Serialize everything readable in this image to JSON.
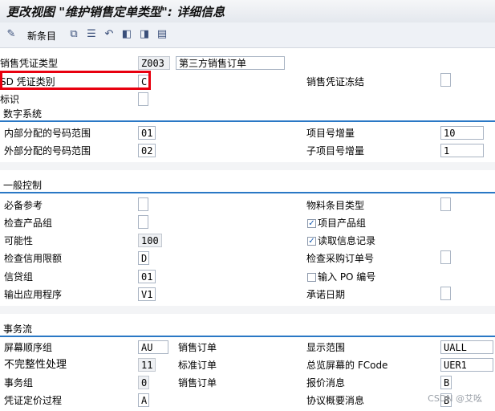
{
  "window": {
    "title": "更改视图 \"维护销售定单类型\": 详细信息"
  },
  "toolbar": {
    "new_entries_label": "新条目"
  },
  "header_fields": {
    "sales_doc_type_label": "销售凭证类型",
    "sales_doc_type_value": "Z003",
    "sales_doc_type_desc": "第三方销售订单",
    "sd_doc_category_label": "SD 凭证类别",
    "sd_doc_category_value": "C",
    "indicator_label": "标识",
    "sales_doc_block_label": "销售凭证冻结"
  },
  "numbering": {
    "section_title": "数字系统",
    "internal_range_label": "内部分配的号码范围",
    "internal_range_value": "01",
    "external_range_label": "外部分配的号码范围",
    "external_range_value": "02",
    "item_no_incr_label": "项目号增量",
    "item_no_incr_value": "10",
    "subitem_incr_label": "子项目号增量",
    "subitem_incr_value": "1"
  },
  "general_control": {
    "section_title": "一般控制",
    "ref_mandatory_label": "必备参考",
    "check_division_label": "检查产品组",
    "probability_label": "可能性",
    "probability_value": "100",
    "check_credit_label": "检查信用限额",
    "check_credit_value": "D",
    "credit_group_label": "信贷组",
    "credit_group_value": "01",
    "output_app_label": "输出应用程序",
    "output_app_value": "V1",
    "material_entry_type_label": "物料条目类型",
    "item_division_label": "项目产品组",
    "item_division_checked": true,
    "read_info_record_label": "读取信息记录",
    "read_info_record_checked": true,
    "check_po_no_label": "检查采购订单号",
    "enter_po_no_label": "输入 PO 编号",
    "enter_po_no_checked": false,
    "commitment_date_label": "承诺日期"
  },
  "transaction_flow": {
    "section_title": "事务流",
    "screen_seq_label": "屏幕顺序组",
    "screen_seq_value": "AU",
    "screen_seq_desc": "销售订单",
    "incompletion_label": "不完整性处理",
    "incompletion_value": "11",
    "incompletion_desc": "标准订单",
    "transaction_group_label": "事务组",
    "transaction_group_value": "0",
    "transaction_group_desc": "销售订单",
    "doc_pricing_label": "凭证定价过程",
    "doc_pricing_value": "A",
    "display_range_label": "显示范围",
    "display_range_value": "UALL",
    "fcode_label": "总览屏幕的 FCode",
    "fcode_value": "UER1",
    "quotation_msg_label": "报价消息",
    "quotation_msg_value": "B",
    "outline_agreement_msg_label": "协议概要消息",
    "outline_agreement_msg_value": "B"
  },
  "watermark": "CSDN @艾吆"
}
